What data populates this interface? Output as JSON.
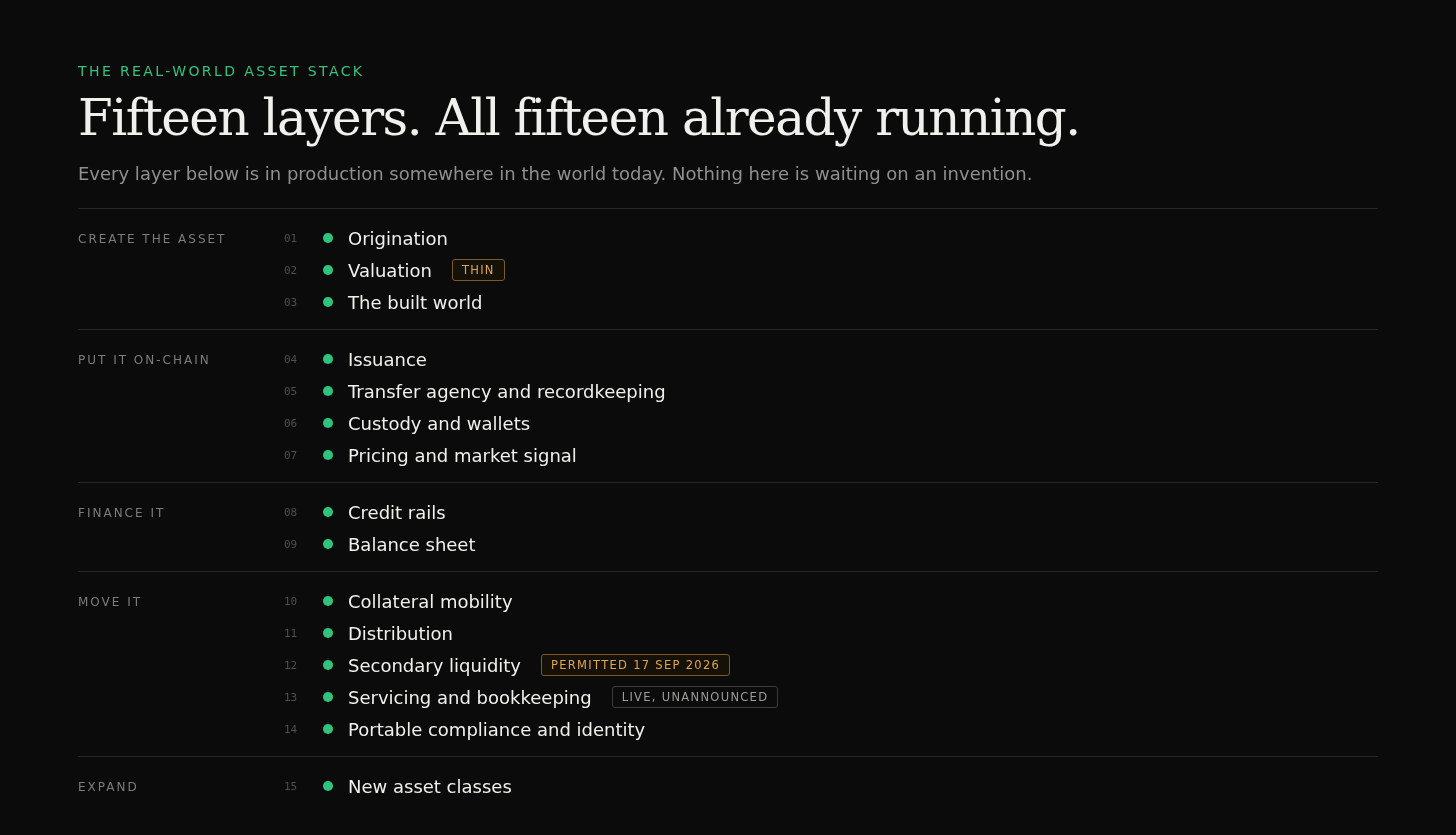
{
  "eyebrow": "THE REAL-WORLD ASSET STACK",
  "title": "Fifteen layers. All fifteen already running.",
  "subtitle": "Every layer below is in production somewhere in the world today. Nothing here is waiting on an invention.",
  "groups": [
    {
      "label": "CREATE THE ASSET",
      "layers": [
        {
          "number": "01",
          "name": "Origination"
        },
        {
          "number": "02",
          "name": "Valuation",
          "badge": {
            "text": "THIN",
            "kind": "warning"
          }
        },
        {
          "number": "03",
          "name": "The built world"
        }
      ]
    },
    {
      "label": "PUT IT ON-CHAIN",
      "layers": [
        {
          "number": "04",
          "name": "Issuance"
        },
        {
          "number": "05",
          "name": "Transfer agency and recordkeeping"
        },
        {
          "number": "06",
          "name": "Custody and wallets"
        },
        {
          "number": "07",
          "name": "Pricing and market signal"
        }
      ]
    },
    {
      "label": "FINANCE IT",
      "layers": [
        {
          "number": "08",
          "name": "Credit rails"
        },
        {
          "number": "09",
          "name": "Balance sheet"
        }
      ]
    },
    {
      "label": "MOVE IT",
      "layers": [
        {
          "number": "10",
          "name": "Collateral mobility"
        },
        {
          "number": "11",
          "name": "Distribution"
        },
        {
          "number": "12",
          "name": "Secondary liquidity",
          "badge": {
            "text": "PERMITTED 17 SEP 2026",
            "kind": "warning"
          }
        },
        {
          "number": "13",
          "name": "Servicing and bookkeeping",
          "badge": {
            "text": "LIVE, UNANNOUNCED",
            "kind": "neutral"
          }
        },
        {
          "number": "14",
          "name": "Portable compliance and identity"
        }
      ]
    },
    {
      "label": "EXPAND",
      "layers": [
        {
          "number": "15",
          "name": "New asset classes"
        }
      ]
    }
  ]
}
